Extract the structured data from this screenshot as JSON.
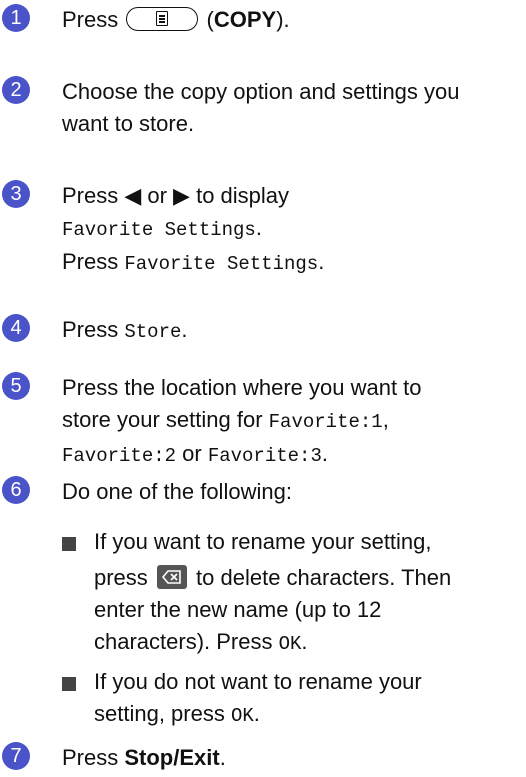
{
  "steps": {
    "s1": {
      "num": "1",
      "press": "Press",
      "copy_paren_open": "(",
      "copy": "COPY",
      "copy_paren_close": ")."
    },
    "s2": {
      "num": "2",
      "text": "Choose the copy option and settings you want to store."
    },
    "s3": {
      "num": "3",
      "line1": "Press ◀ or ▶ to display",
      "line2": "Favorite Settings",
      "line2_end": ".",
      "line3_pre": "Press ",
      "line3_mono": "Favorite Settings",
      "line3_end": "."
    },
    "s4": {
      "num": "4",
      "pre": "Press ",
      "mono": "Store",
      "end": "."
    },
    "s5": {
      "num": "5",
      "line1": "Press the location where you want to",
      "line2_pre": "store your setting for ",
      "fav1": "Favorite:1",
      "comma": ",",
      "fav2": "Favorite:2",
      "or": " or ",
      "fav3": "Favorite:3",
      "end": "."
    },
    "s6": {
      "num": "6",
      "text": "Do one of the following:",
      "b1_line1": "If you want to rename your setting,",
      "b1_press": "press ",
      "b1_after": " to delete characters. Then",
      "b1_line3": "enter the new name (up to 12",
      "b1_line4_pre": "characters). Press ",
      "b1_ok": "OK",
      "b1_end": ".",
      "b2_line1": "If you do not want to rename your",
      "b2_line2_pre": "setting, press ",
      "b2_ok": "OK",
      "b2_end": "."
    },
    "s7": {
      "num": "7",
      "pre": "Press ",
      "bold": "Stop/Exit",
      "end": "."
    }
  },
  "colors": {
    "bullet": "#4a53c8"
  },
  "icons": {
    "copy_button": "copy-document-icon",
    "backspace": "backspace-icon"
  }
}
